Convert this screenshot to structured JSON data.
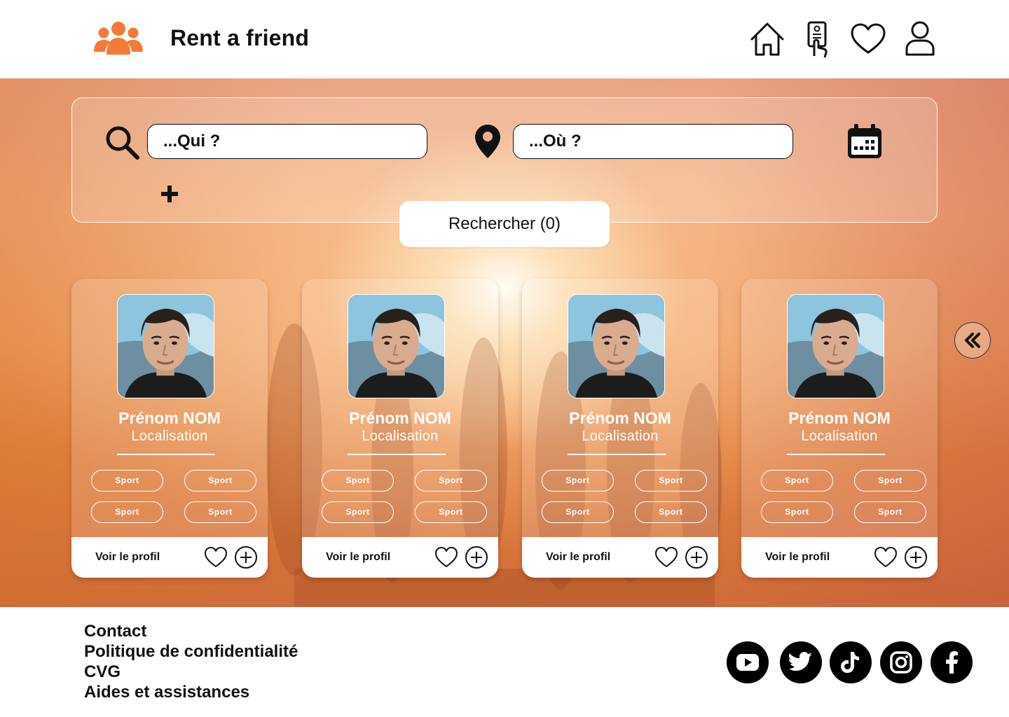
{
  "header": {
    "brand": "Rent a friend",
    "logo_icon": "group-people-icon",
    "brand_color": "#f47a36",
    "nav": [
      {
        "icon": "home-icon"
      },
      {
        "icon": "id-card-hand-icon"
      },
      {
        "icon": "heart-icon"
      },
      {
        "icon": "user-icon"
      }
    ]
  },
  "search": {
    "who_placeholder": "...Qui ?",
    "where_placeholder": "...Où ?",
    "search_icon": "search-icon",
    "location_icon": "location-pin-icon",
    "calendar_icon": "calendar-icon",
    "add_icon": "plus-icon",
    "button_label": "Rechercher (0)"
  },
  "cards": [
    {
      "name": "Prénom NOM",
      "location": "Localisation",
      "tags": [
        "Sport",
        "Sport",
        "Sport",
        "Sport"
      ],
      "profile_label": "Voir le profil"
    },
    {
      "name": "Prénom NOM",
      "location": "Localisation",
      "tags": [
        "Sport",
        "Sport",
        "Sport",
        "Sport"
      ],
      "profile_label": "Voir le profil"
    },
    {
      "name": "Prénom NOM",
      "location": "Localisation",
      "tags": [
        "Sport",
        "Sport",
        "Sport",
        "Sport"
      ],
      "profile_label": "Voir le profil"
    },
    {
      "name": "Prénom NOM",
      "location": "Localisation",
      "tags": [
        "Sport",
        "Sport",
        "Sport",
        "Sport"
      ],
      "profile_label": "Voir le profil"
    }
  ],
  "collapse_icon": "double-chevron-left-icon",
  "footer": {
    "links": [
      "Contact",
      "Politique de confidentialité",
      "CVG",
      "Aides et assistances"
    ],
    "social": [
      "youtube-icon",
      "twitter-icon",
      "tiktok-icon",
      "instagram-icon",
      "facebook-icon"
    ]
  }
}
